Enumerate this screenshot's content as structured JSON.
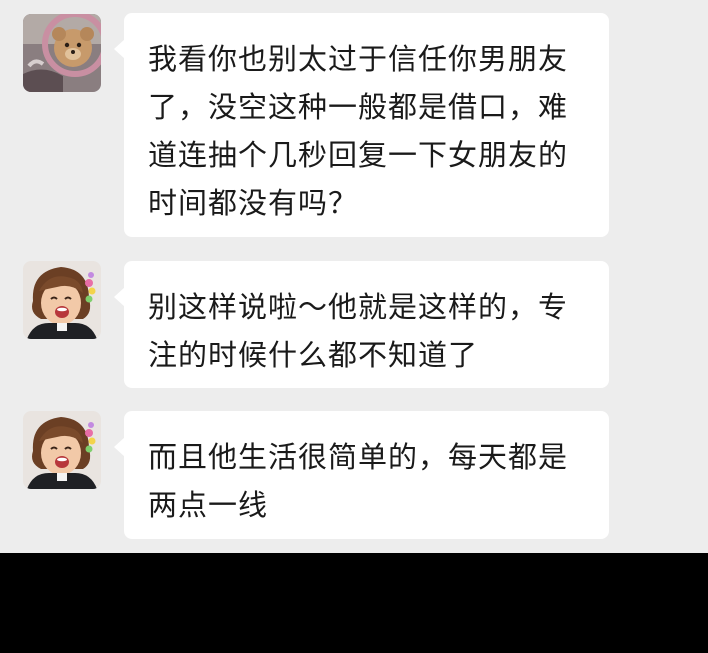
{
  "messages": [
    {
      "sender_avatar": "teddy-bear-avatar",
      "lines": [
        "我看你也别太过于信任你男朋友",
        "了，没空这种一般都是借口，难",
        "道连抽个几秒回复一下女朋友的",
        "时间都没有吗？"
      ]
    },
    {
      "sender_avatar": "laughing-child-avatar",
      "lines": [
        "别这样说啦～他就是这样的，专",
        "注的时候什么都不知道了"
      ]
    },
    {
      "sender_avatar": "laughing-child-avatar",
      "lines": [
        "而且他生活很简单的，每天都是",
        "两点一线"
      ]
    }
  ],
  "colors": {
    "chat_background": "#ededed",
    "bubble": "#ffffff",
    "text": "#1a1a1a",
    "bottom_band": "#000000"
  }
}
